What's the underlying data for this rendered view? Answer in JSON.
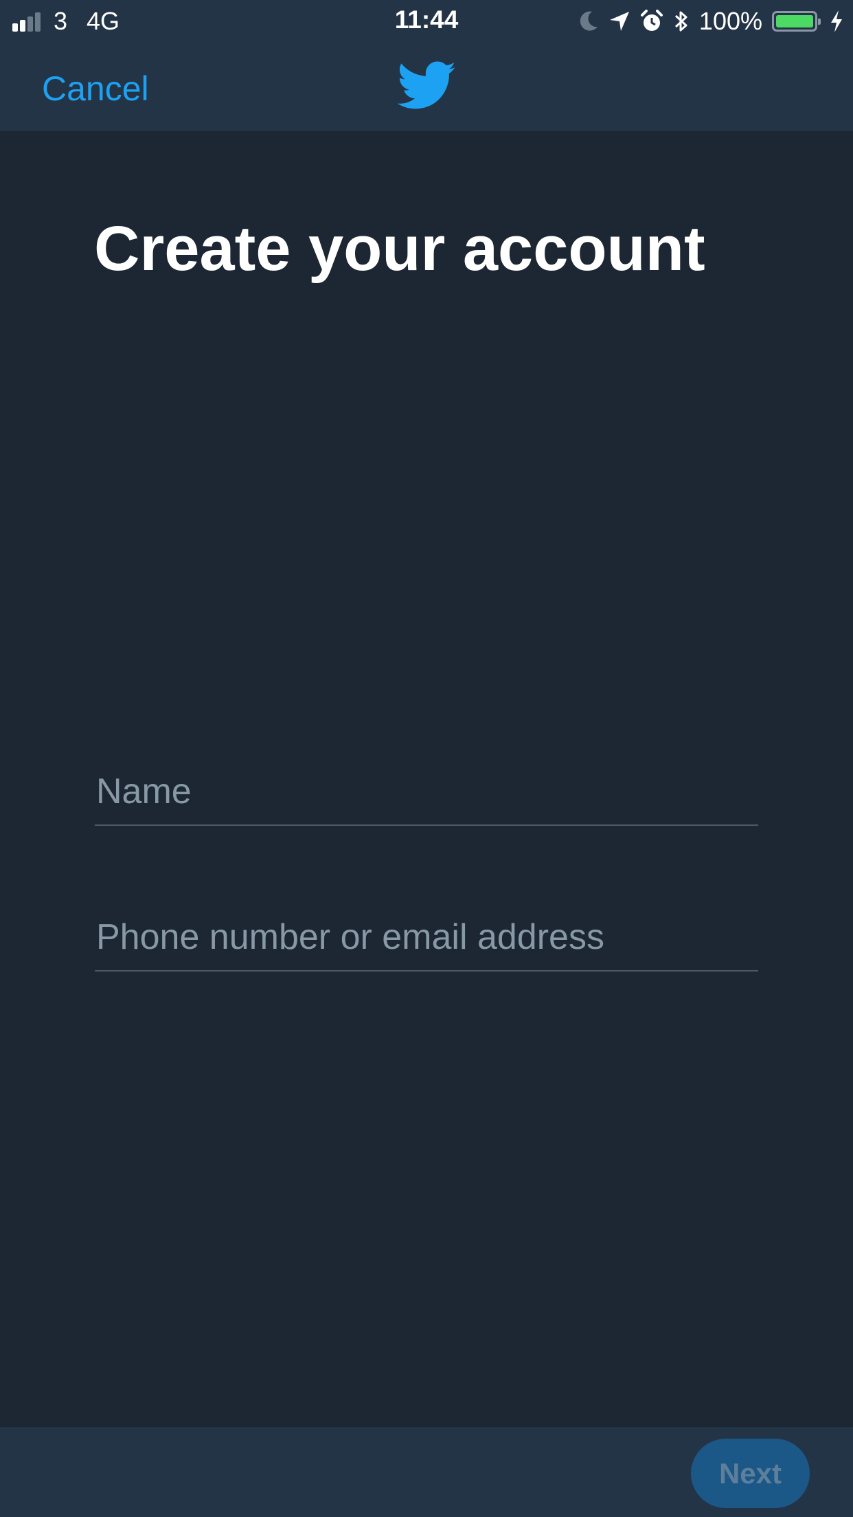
{
  "status_bar": {
    "carrier": "3",
    "network": "4G",
    "time": "11:44",
    "battery_percent": "100%",
    "battery_level": 1.0,
    "signal_bars": 2,
    "icons": [
      "moon-icon",
      "location-arrow-icon",
      "alarm-icon",
      "bluetooth-icon",
      "battery-icon",
      "charging-bolt-icon"
    ]
  },
  "nav": {
    "cancel_label": "Cancel",
    "logo_icon": "twitter-bird-icon"
  },
  "main": {
    "title": "Create your account",
    "fields": {
      "name_placeholder": "Name",
      "name_value": "",
      "contact_placeholder": "Phone number or email address",
      "contact_value": ""
    }
  },
  "footer": {
    "next_label": "Next"
  },
  "colors": {
    "background": "#1c2733",
    "bar_background": "#243447",
    "accent": "#1da1f2",
    "placeholder": "#8899a6",
    "next_disabled_bg": "#1b5787",
    "next_disabled_text": "#5d7f9b",
    "battery_green": "#4cd964"
  }
}
